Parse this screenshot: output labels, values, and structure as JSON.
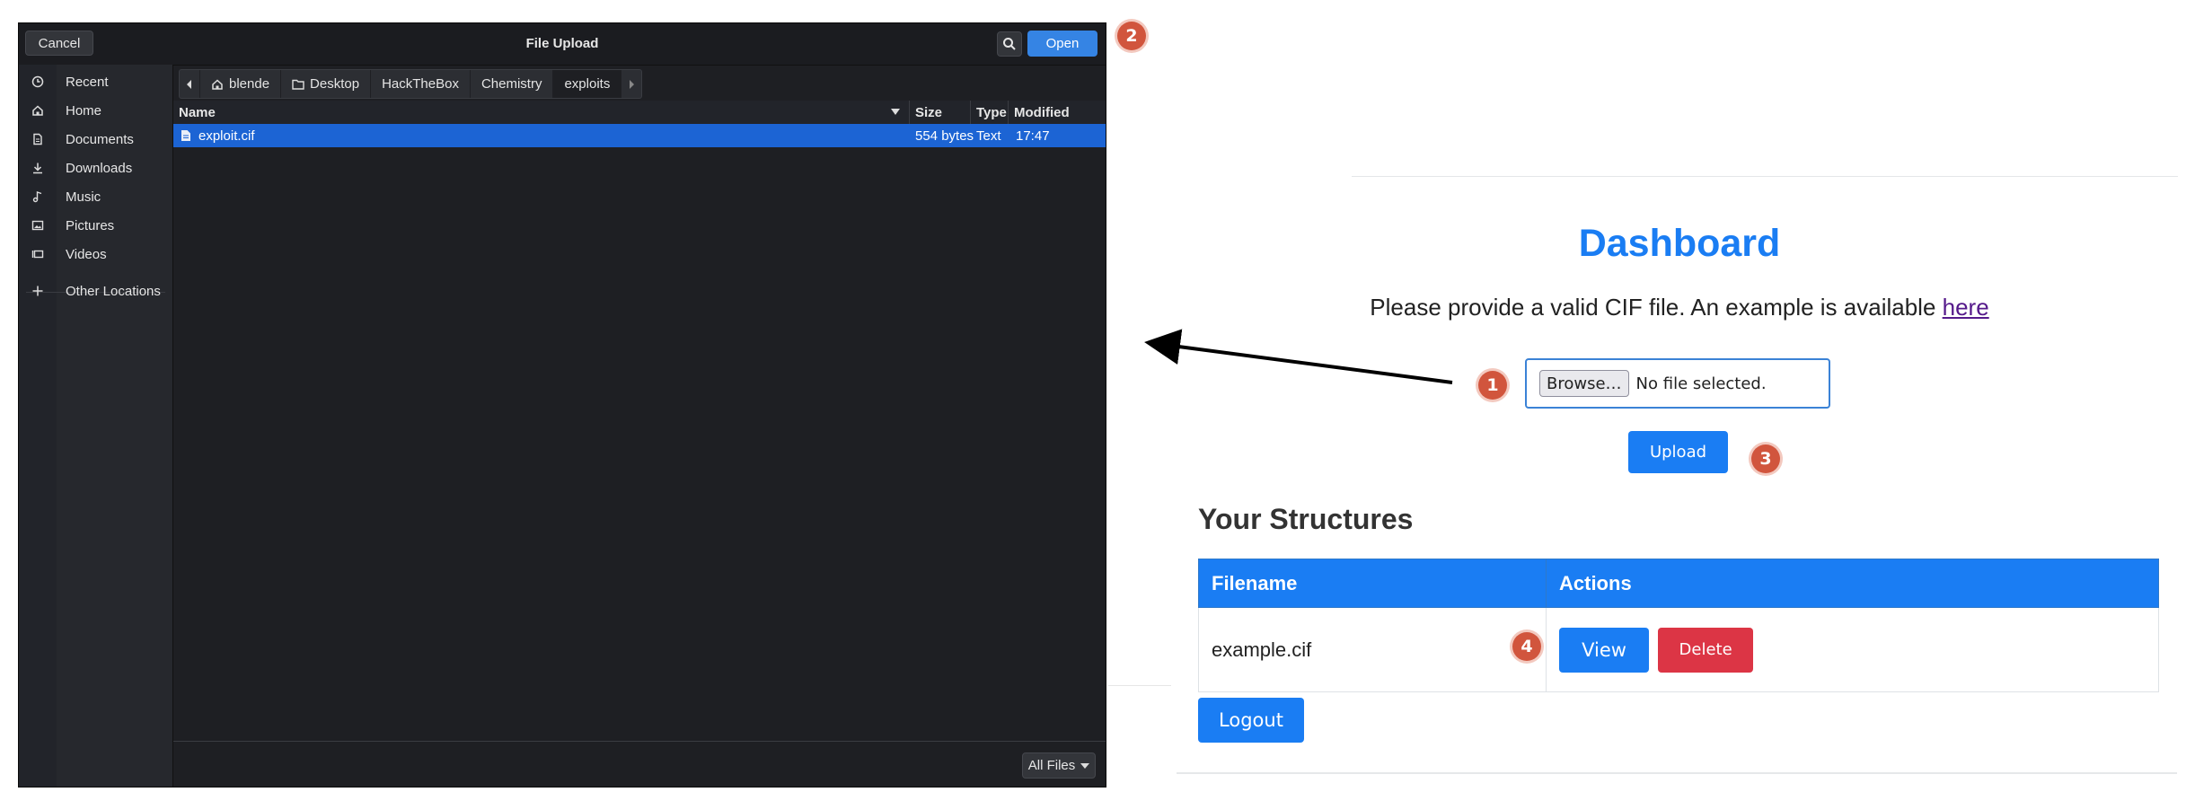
{
  "dialog": {
    "title": "File Upload",
    "cancel_label": "Cancel",
    "open_label": "Open",
    "places": [
      {
        "label": "Recent",
        "icon": "clock-icon"
      },
      {
        "label": "Home",
        "icon": "home-icon"
      },
      {
        "label": "Documents",
        "icon": "document-icon"
      },
      {
        "label": "Downloads",
        "icon": "download-icon"
      },
      {
        "label": "Music",
        "icon": "music-icon"
      },
      {
        "label": "Pictures",
        "icon": "picture-icon"
      },
      {
        "label": "Videos",
        "icon": "video-icon"
      },
      {
        "label": "Other Locations",
        "icon": "plus-icon"
      }
    ],
    "breadcrumbs": [
      "blende",
      "Desktop",
      "HackTheBox",
      "Chemistry",
      "exploits"
    ],
    "columns": {
      "name": "Name",
      "size": "Size",
      "type": "Type",
      "modified": "Modified"
    },
    "files": [
      {
        "name": "exploit.cif",
        "size": "554 bytes",
        "type": "Text",
        "modified": "17:47"
      }
    ],
    "filter_label": "All Files"
  },
  "web": {
    "title": "Dashboard",
    "subtitle": "Please provide a valid CIF file. An example is available",
    "subtitle_link": "here",
    "browse_label": "Browse…",
    "file_status": "No file selected.",
    "upload_label": "Upload",
    "structures_title": "Your Structures",
    "table": {
      "headers": [
        "Filename",
        "Actions"
      ],
      "rows": [
        {
          "filename": "example.cif",
          "view_label": "View",
          "delete_label": "Delete"
        }
      ]
    },
    "logout_label": "Logout"
  },
  "badges": [
    "1",
    "2",
    "3",
    "4"
  ],
  "colors": {
    "accent": "#1a7df3",
    "danger": "#dc3545",
    "badge": "#d1553d",
    "dialog_bg": "#1e1f23",
    "selection": "#1c64d4"
  }
}
